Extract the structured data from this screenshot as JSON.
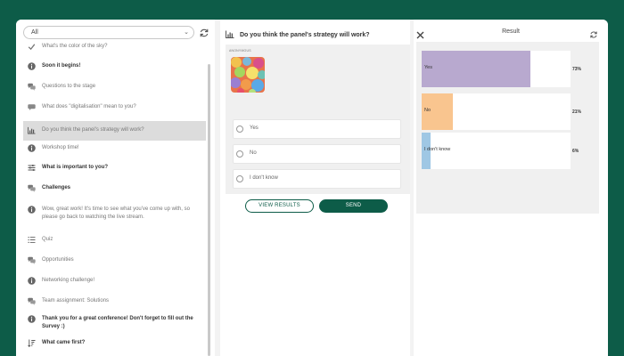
{
  "filter": {
    "selected": "All"
  },
  "list_items": [
    {
      "label": "What's the color of the sky?",
      "icon": "check-icon",
      "bold": false,
      "selected": false
    },
    {
      "label": "Soon it begins!",
      "icon": "info-icon",
      "bold": true,
      "selected": false
    },
    {
      "label": "Questions to the stage",
      "icon": "chat-icon",
      "bold": false,
      "selected": false
    },
    {
      "label": "What does \"digitalisation\" mean to you?",
      "icon": "cloud-icon",
      "bold": false,
      "selected": false
    },
    {
      "label": "Do you think the panel's strategy will work?",
      "icon": "bar-chart-icon",
      "bold": false,
      "selected": true
    },
    {
      "label": "Workshop time!",
      "icon": "info-icon",
      "bold": false,
      "selected": false
    },
    {
      "label": "What is important to you?",
      "icon": "sliders-icon",
      "bold": true,
      "selected": false
    },
    {
      "label": "Challenges",
      "icon": "chat-icon",
      "bold": true,
      "selected": false
    },
    {
      "label": "Wow, great work! It's time to see what you've come up with, so please go back to watching the live stream.",
      "icon": "info-icon",
      "bold": false,
      "selected": false
    },
    {
      "label": "Quiz",
      "icon": "list-icon",
      "bold": false,
      "selected": false
    },
    {
      "label": "Opportunities",
      "icon": "chat-icon",
      "bold": false,
      "selected": false
    },
    {
      "label": "Networking challenge!",
      "icon": "info-icon",
      "bold": false,
      "selected": false
    },
    {
      "label": "Team assignment: Solutions",
      "icon": "chat-icon",
      "bold": false,
      "selected": false
    },
    {
      "label": "Thank you for a great conference! Don't forget to fill out the Survey :)",
      "icon": "info-icon",
      "bold": true,
      "selected": false
    },
    {
      "label": "What came first?",
      "icon": "sort-icon",
      "bold": true,
      "selected": false
    }
  ],
  "question": {
    "title": "Do you think the panel's strategy will work?",
    "tag": "ANONYMOUS",
    "options": [
      "Yes",
      "No",
      "I don't know"
    ],
    "view_results_label": "VIEW RESULTS",
    "send_label": "SEND"
  },
  "result": {
    "title": "Result",
    "bars": [
      {
        "label": "Yes",
        "value_label": "73%",
        "fraction": 0.73,
        "color": "#b8a9cf"
      },
      {
        "label": "No",
        "value_label": "21%",
        "fraction": 0.21,
        "color": "#f9c58f"
      },
      {
        "label": "I don't know",
        "value_label": "6%",
        "fraction": 0.06,
        "color": "#9fc7e4"
      }
    ]
  },
  "colors": {
    "background": "#0d5c48",
    "accent": "#0d5c48"
  }
}
